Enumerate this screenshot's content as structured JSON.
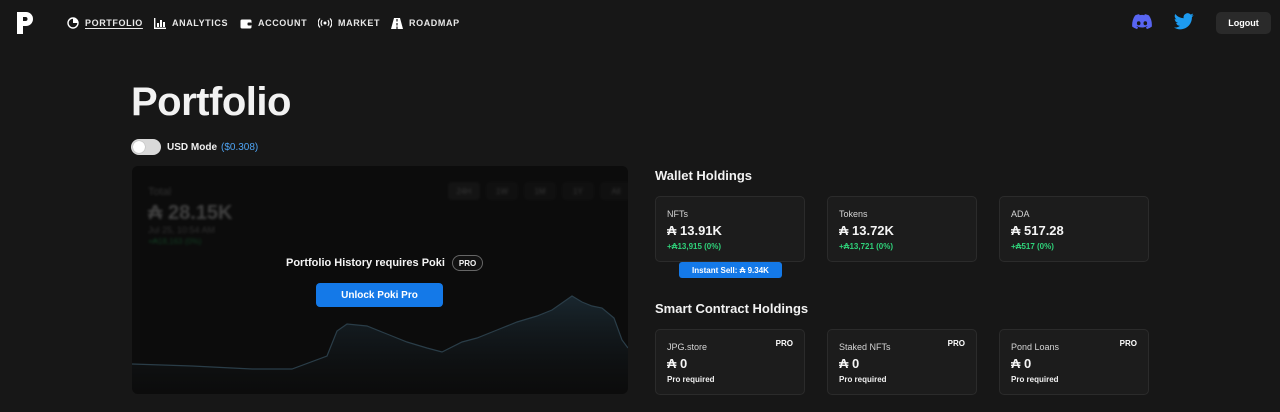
{
  "nav": {
    "items": [
      {
        "label": "PORTFOLIO",
        "icon": "pie-chart-icon",
        "active": true
      },
      {
        "label": "ANALYTICS",
        "icon": "bar-chart-icon",
        "active": false
      },
      {
        "label": "ACCOUNT",
        "icon": "wallet-icon",
        "active": false
      },
      {
        "label": "MARKET",
        "icon": "broadcast-icon",
        "active": false
      },
      {
        "label": "ROADMAP",
        "icon": "road-icon",
        "active": false
      }
    ],
    "logout_label": "Logout",
    "discord_color": "#5865F2",
    "twitter_color": "#1D9BF0"
  },
  "page": {
    "title": "Portfolio",
    "usd_mode_label": "USD Mode",
    "ada_price": "($0.308)"
  },
  "chart": {
    "total_label": "Total",
    "total_value": "₳ 28.15K",
    "date": "Jul 25, 10:54 AM",
    "change": "+₳18,163 (0%)",
    "ranges": [
      "24H",
      "1W",
      "1M",
      "1Y",
      "All"
    ],
    "selected_range": "24H",
    "locked_message": "Portfolio History requires Poki",
    "pro_badge": "PRO",
    "unlock_label": "Unlock Poki Pro"
  },
  "wallet": {
    "title": "Wallet Holdings",
    "cards": [
      {
        "label": "NFTs",
        "value": "₳ 13.91K",
        "change": "+₳13,915 (0%)"
      },
      {
        "label": "Tokens",
        "value": "₳ 13.72K",
        "change": "+₳13,721 (0%)"
      },
      {
        "label": "ADA",
        "value": "₳ 517.28",
        "change": "+₳517 (0%)"
      }
    ],
    "instant_sell": "Instant Sell: ₳ 9.34K"
  },
  "smart": {
    "title": "Smart Contract Holdings",
    "cards": [
      {
        "label": "JPG.store",
        "value": "₳ 0",
        "note": "Pro required",
        "badge": "PRO"
      },
      {
        "label": "Staked NFTs",
        "value": "₳ 0",
        "note": "Pro required",
        "badge": "PRO"
      },
      {
        "label": "Pond Loans",
        "value": "₳ 0",
        "note": "Pro required",
        "badge": "PRO"
      }
    ]
  },
  "colors": {
    "accent": "#1479E8",
    "positive": "#2FD27A",
    "link": "#4EA4F4"
  }
}
